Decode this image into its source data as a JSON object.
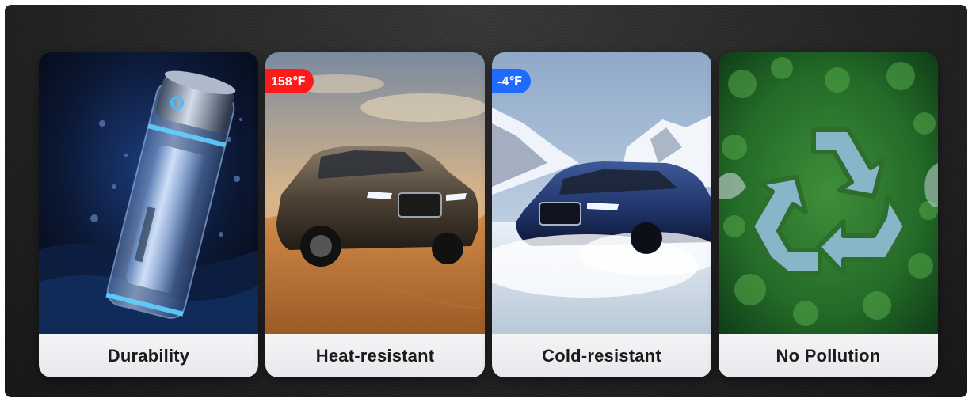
{
  "cards": [
    {
      "id": "durability",
      "label": "Durability",
      "image": "battery-cell-in-water"
    },
    {
      "id": "heat",
      "label": "Heat-resistant",
      "badge": "158℉",
      "badge_color": "#ff1a1a",
      "image": "suv-in-desert"
    },
    {
      "id": "cold",
      "label": "Cold-resistant",
      "badge": "-4℉",
      "badge_color": "#1f6bff",
      "image": "suv-in-snow"
    },
    {
      "id": "eco",
      "label": "No Pollution",
      "image": "recycle-symbol-forest"
    }
  ]
}
